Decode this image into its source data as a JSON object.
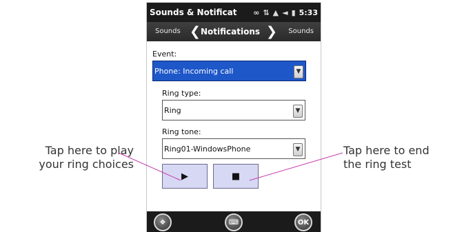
{
  "statusbar": {
    "title": "Sounds & Notificat",
    "time": "5:33",
    "icons": [
      "voicemail-icon",
      "sync-icon",
      "signal-icon",
      "volume-icon",
      "battery-icon"
    ]
  },
  "navbar": {
    "prev_label": "Sounds",
    "title": "Notifications",
    "next_label": "Sounds"
  },
  "form": {
    "event_label": "Event:",
    "event_value": "Phone: Incoming call",
    "ring_type_label": "Ring type:",
    "ring_type_value": "Ring",
    "ring_tone_label": "Ring tone:",
    "ring_tone_value": "Ring01-WindowsPhone",
    "play_symbol": "▶",
    "stop_symbol": "■"
  },
  "softkeys": {
    "ok_label": "OK"
  },
  "callouts": {
    "left_line1": "Tap here to play",
    "left_line2": "your ring choices",
    "right_line1": "Tap here to end",
    "right_line2": "the ring test"
  },
  "colors": {
    "selection": "#1e57c8",
    "button_fill": "#d7d8f4",
    "leader_line": "#c63db0"
  }
}
